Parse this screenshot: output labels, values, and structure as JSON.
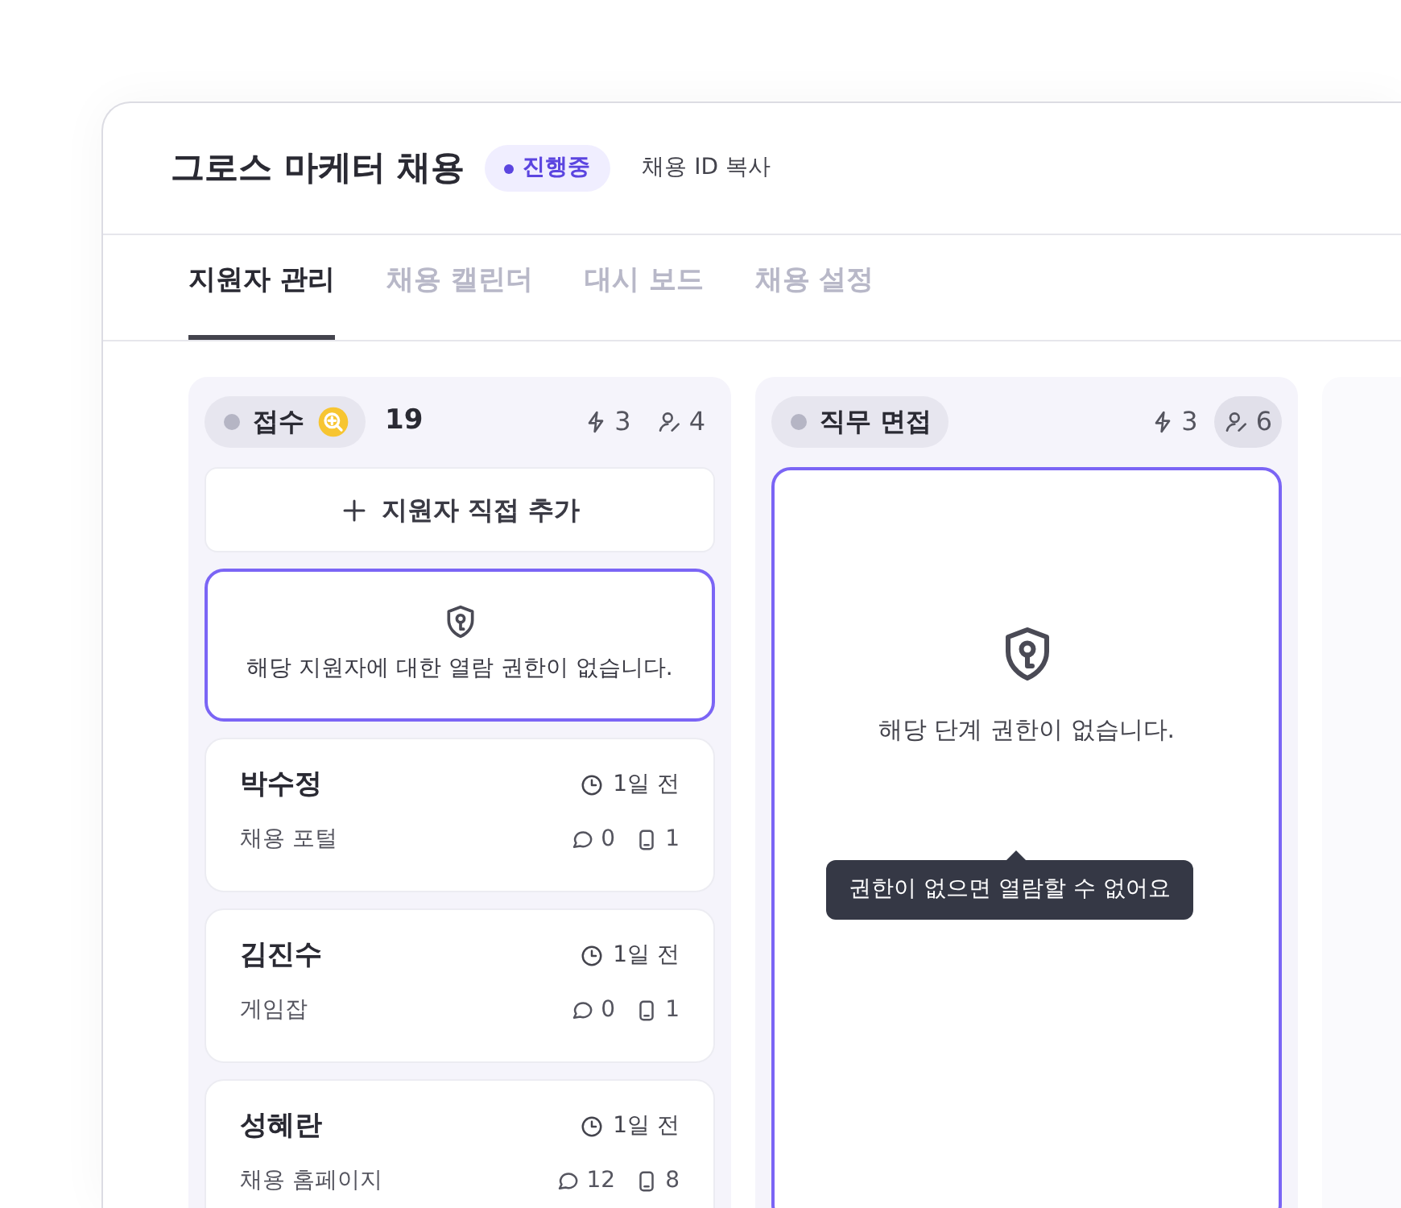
{
  "header": {
    "title": "그로스 마케터 채용",
    "status": {
      "label": "진행중"
    },
    "copy_link": "채용 ID 복사"
  },
  "tabs": [
    {
      "label": "지원자 관리",
      "selected": true
    },
    {
      "label": "채용 캘린더",
      "selected": false
    },
    {
      "label": "대시 보드",
      "selected": false
    },
    {
      "label": "채용 설정",
      "selected": false
    }
  ],
  "columns": [
    {
      "kind": "stage",
      "title": "접수",
      "search_badge": true,
      "count": "19",
      "stats": [
        {
          "kind": "bolt",
          "value": "3",
          "selected": false
        },
        {
          "kind": "person",
          "value": "4",
          "selected": false
        }
      ],
      "add_button": "지원자 직접 추가",
      "cards": [
        {
          "kind": "locked",
          "message": "해당 지원자에 대한 열람 권한이 없습니다."
        },
        {
          "kind": "applicant",
          "name": "박수정",
          "time": "1일 전",
          "source": "채용 포털",
          "comments": "0",
          "files": "1"
        },
        {
          "kind": "applicant",
          "name": "김진수",
          "time": "1일 전",
          "source": "게임잡",
          "comments": "0",
          "files": "1"
        },
        {
          "kind": "applicant",
          "name": "성혜란",
          "time": "1일 전",
          "source": "채용 홈페이지",
          "comments": "12",
          "files": "8"
        }
      ]
    },
    {
      "kind": "stage",
      "title": "직무 면접",
      "search_badge": false,
      "stats": [
        {
          "kind": "bolt",
          "value": "3",
          "selected": false
        },
        {
          "kind": "person",
          "value": "6",
          "selected": true
        }
      ],
      "locked": {
        "message": "해당 단계 권한이 없습니다.",
        "tooltip": "권한이 없으면 열람할 수 없어요"
      }
    },
    {
      "kind": "placeholder"
    }
  ]
}
